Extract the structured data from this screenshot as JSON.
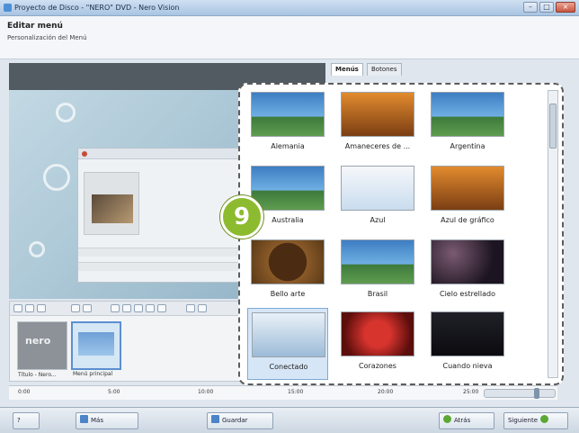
{
  "window": {
    "title": "Proyecto de Disco - \"NERO\" DVD - Nero Vision",
    "controls": [
      "–",
      "□",
      "×"
    ]
  },
  "header": {
    "title": "Editar menú",
    "subtitle": "Personalización del Menú"
  },
  "tabs": [
    {
      "label": "Menús",
      "active": true
    },
    {
      "label": "Botones",
      "active": false
    }
  ],
  "gallery": {
    "items": [
      {
        "label": "Alemania",
        "theme": "soccer-team-blue"
      },
      {
        "label": "Amaneceres de ...",
        "theme": "warm-orange"
      },
      {
        "label": "Argentina",
        "theme": "soccer-team-blue"
      },
      {
        "label": "Australia",
        "theme": "soccer-team-blue"
      },
      {
        "label": "Azul",
        "theme": "light-blue"
      },
      {
        "label": "Azul de gráfico",
        "theme": "brown-frames"
      },
      {
        "label": "Bello arte",
        "theme": "wood-frame"
      },
      {
        "label": "Brasil",
        "theme": "soccer-team-blue"
      },
      {
        "label": "Cielo estrellado",
        "theme": "dark-purple"
      },
      {
        "label": "Conectado",
        "theme": "light-blue-selected",
        "selected": true
      },
      {
        "label": "Corazones",
        "theme": "red-hearts"
      },
      {
        "label": "Cuando nieva",
        "theme": "night-dark"
      }
    ]
  },
  "annotation": {
    "step_number": "9"
  },
  "timeline": {
    "clips": [
      {
        "label": "Título - Nero...",
        "logo": "nero"
      },
      {
        "label": "Menú principal"
      }
    ]
  },
  "ruler": {
    "ticks": [
      "0:00",
      "5:00",
      "10:00",
      "15:00",
      "20:00",
      "25:00"
    ]
  },
  "bottombar": {
    "help_label": "?",
    "more_label": "Más",
    "save_label": "Guardar",
    "back_label": "Atrás",
    "next_label": "Siguiente"
  }
}
